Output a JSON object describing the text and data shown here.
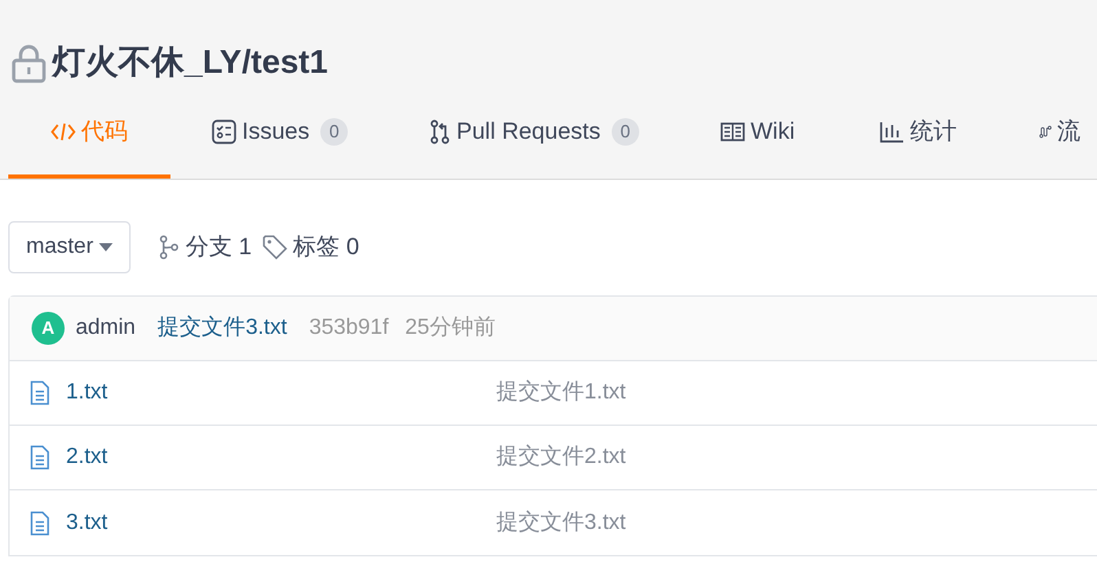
{
  "repo": {
    "private": true,
    "title": "灯火不休_LY/test1"
  },
  "tabs": [
    {
      "kind": "code",
      "label": "代码",
      "selected": true
    },
    {
      "kind": "issues",
      "label": "Issues",
      "count": "0",
      "selected": false
    },
    {
      "kind": "pr",
      "label": "Pull Requests",
      "count": "0",
      "selected": false
    },
    {
      "kind": "wiki",
      "label": "Wiki",
      "selected": false
    },
    {
      "kind": "stats",
      "label": "统计",
      "selected": false
    },
    {
      "kind": "flow",
      "label": "流",
      "selected": false
    }
  ],
  "branch_select": {
    "value": "master"
  },
  "branches": {
    "label": "分支 1"
  },
  "tags": {
    "label": "标签 0"
  },
  "latest_commit": {
    "avatar": "A",
    "author": "admin",
    "message": "提交文件3.txt",
    "hash": "353b91f",
    "time": "25分钟前"
  },
  "files": [
    {
      "name": "1.txt",
      "commit": "提交文件1.txt"
    },
    {
      "name": "2.txt",
      "commit": "提交文件2.txt"
    },
    {
      "name": "3.txt",
      "commit": "提交文件3.txt"
    }
  ]
}
